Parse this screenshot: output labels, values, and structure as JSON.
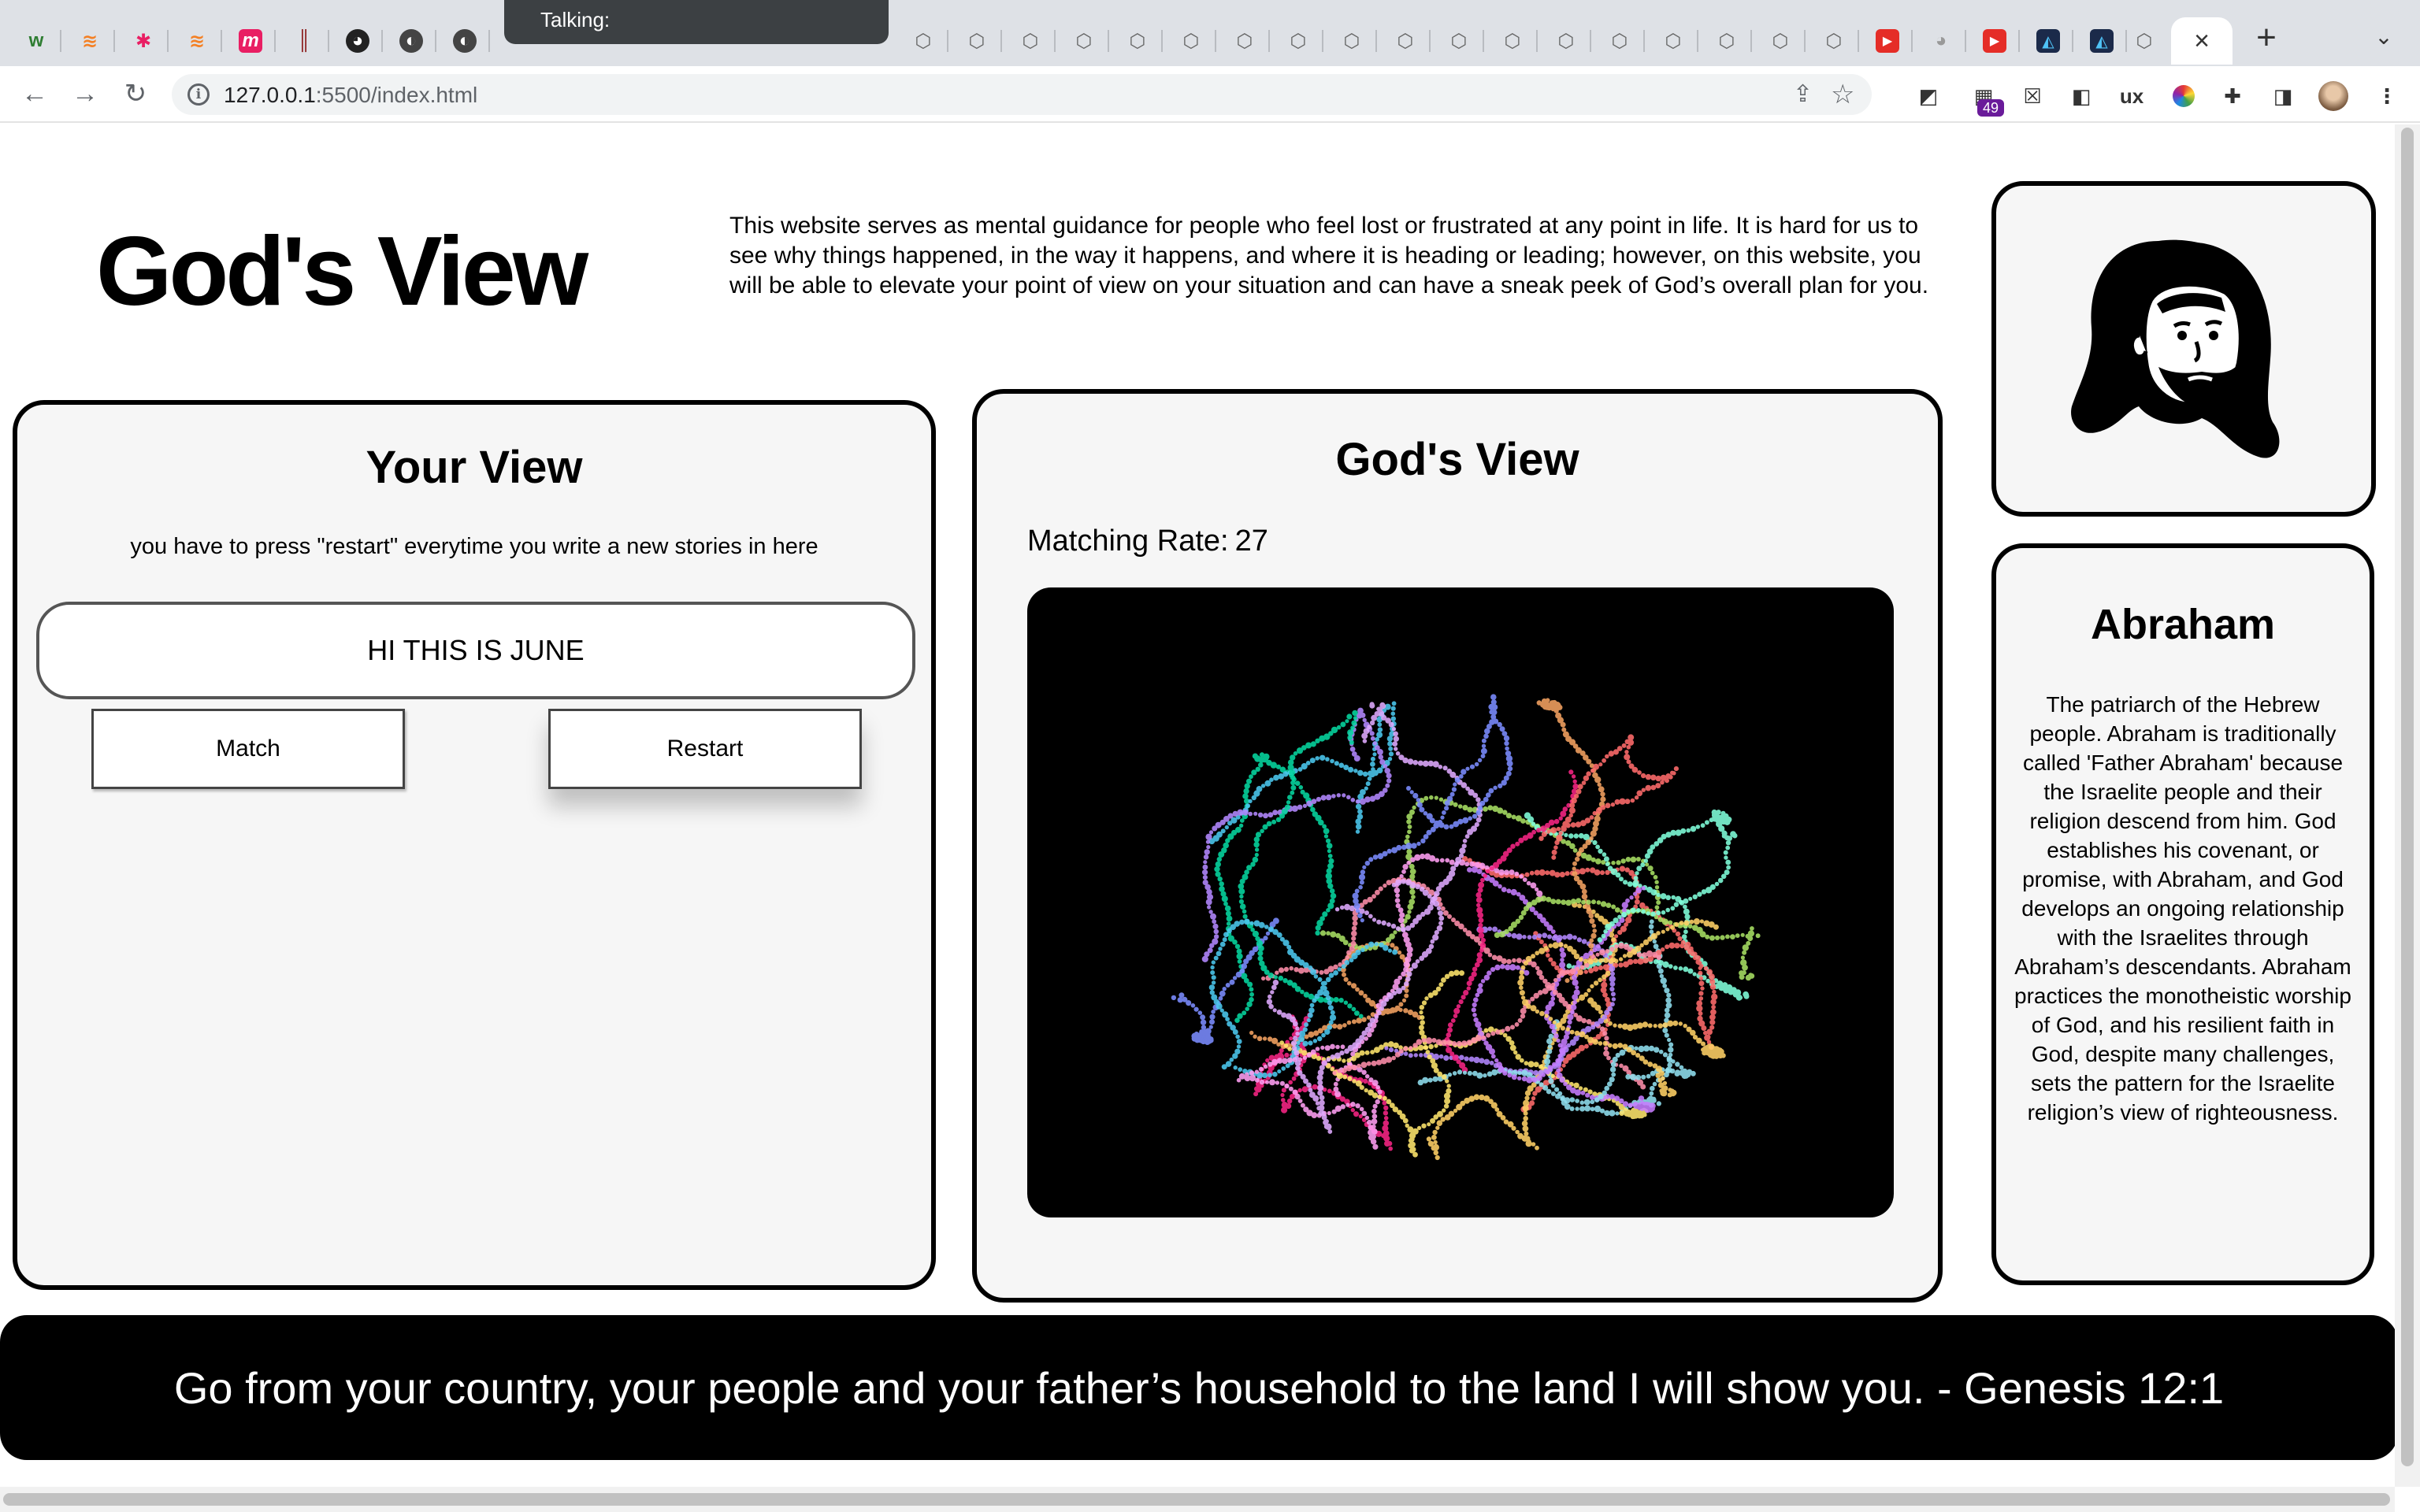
{
  "browser": {
    "talking_label": "Talking:",
    "url_host": "127.0.0.1",
    "url_rest": ":5500/index.html",
    "extension_badge": "49"
  },
  "header": {
    "title": "God's View",
    "intro": "This website serves as mental guidance for people who feel lost or frustrated at any point in life. It is hard for us to see why things happened, in the way it happens, and where it is heading or leading; however, on this website, you will be able to elevate your point of view on your situation and can have a sneak peek of God’s overall plan for you."
  },
  "your_view": {
    "title": "Your View",
    "hint": "you have to press \"restart\" everytime you write a new stories in here",
    "input_value": "HI THIS IS JUNE",
    "match_label": "Match",
    "restart_label": "Restart"
  },
  "gods_view": {
    "title": "God's View",
    "matching_rate_label": "Matching Rate:",
    "matching_rate_value": "27"
  },
  "character": {
    "name": "Abraham",
    "bio": "The patriarch of the Hebrew people. Abraham is traditionally called 'Father Abraham' because the Israelite people and their religion descend from him. God establishes his covenant, or promise, with Abraham, and God develops an ongoing relationship with the Israelites through Abraham’s descendants. Abraham practices the monotheistic worship of God, and his resilient faith in God, despite many challenges, sets the pattern for the Israelite religion’s view of righteousness."
  },
  "verse": "Go from your country, your people and your father’s household to the land I will show you. - Genesis 12:1"
}
